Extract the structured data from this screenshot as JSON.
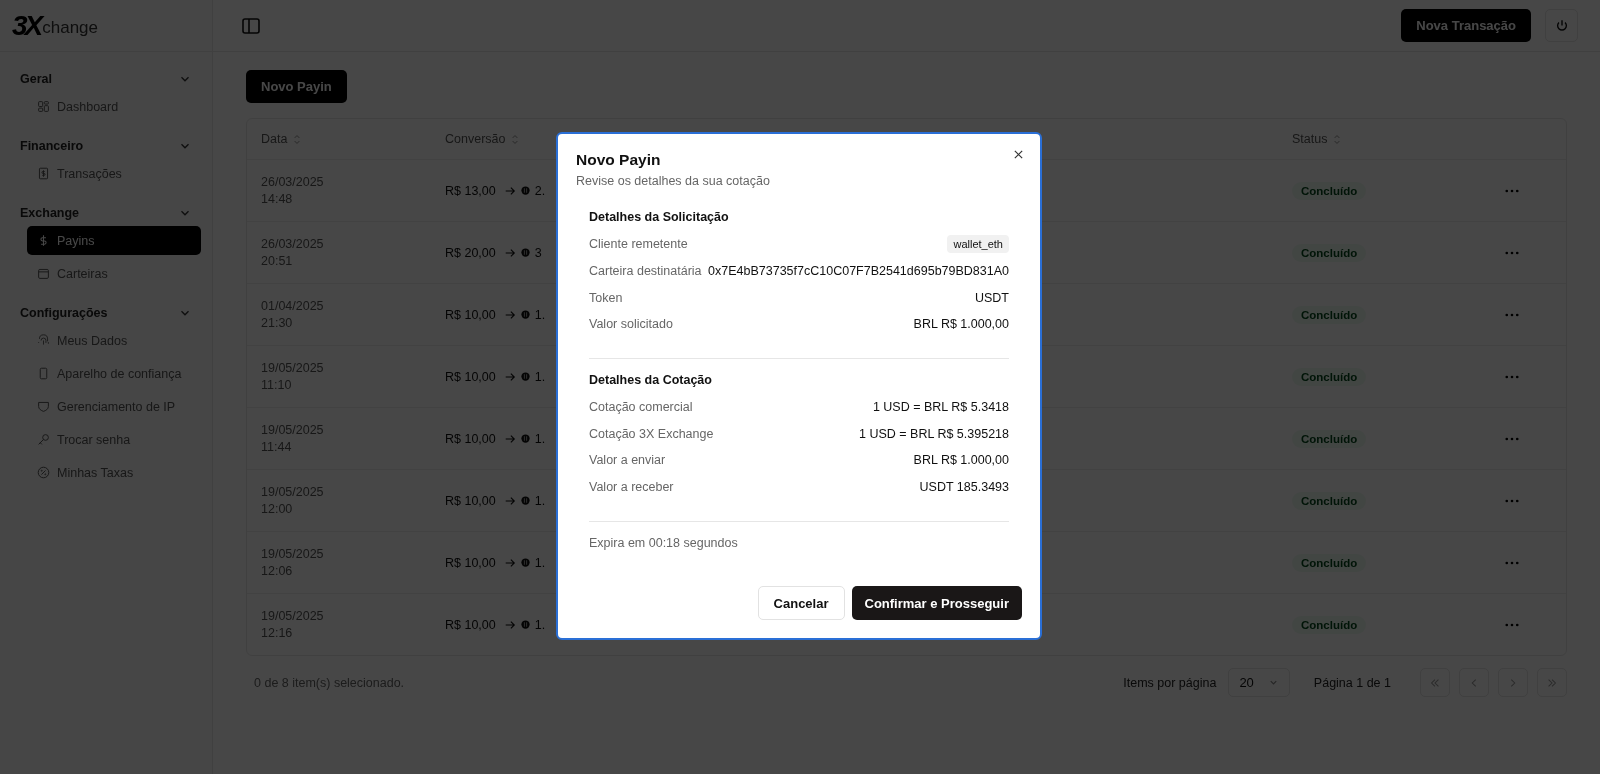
{
  "brand": {
    "logo_mark": "3X",
    "logo_text": "change"
  },
  "topbar": {
    "primary_button": "Nova Transação"
  },
  "sidebar": {
    "groups": [
      {
        "title": "Geral",
        "expanded": true,
        "items": [
          {
            "label": "Dashboard",
            "selected": false
          }
        ]
      },
      {
        "title": "Financeiro",
        "expanded": true,
        "items": [
          {
            "label": "Transações",
            "selected": false
          }
        ]
      },
      {
        "title": "Exchange",
        "expanded": true,
        "items": [
          {
            "label": "Payins",
            "selected": true
          },
          {
            "label": "Carteiras",
            "selected": false
          }
        ]
      },
      {
        "title": "Configurações",
        "expanded": true,
        "items": [
          {
            "label": "Meus Dados",
            "selected": false
          },
          {
            "label": "Aparelho de confiança",
            "selected": false
          },
          {
            "label": "Gerenciamento de IP",
            "selected": false
          },
          {
            "label": "Trocar senha",
            "selected": false
          },
          {
            "label": "Minhas Taxas",
            "selected": false
          }
        ]
      }
    ]
  },
  "page": {
    "new_button": "Novo Payin",
    "table": {
      "columns": [
        "Data",
        "Conversão",
        "Status"
      ],
      "rows": [
        {
          "date": "26/03/2025",
          "time": "14:48",
          "from": "R$ 13,00",
          "to": "2.",
          "status": "Concluído"
        },
        {
          "date": "26/03/2025",
          "time": "20:51",
          "from": "R$ 20,00",
          "to": "3",
          "status": "Concluído"
        },
        {
          "date": "01/04/2025",
          "time": "21:30",
          "from": "R$ 10,00",
          "to": "1.",
          "status": "Concluído"
        },
        {
          "date": "19/05/2025",
          "time": "11:10",
          "from": "R$ 10,00",
          "to": "1.",
          "status": "Concluído"
        },
        {
          "date": "19/05/2025",
          "time": "11:44",
          "from": "R$ 10,00",
          "to": "1.",
          "status": "Concluído"
        },
        {
          "date": "19/05/2025",
          "time": "12:00",
          "from": "R$ 10,00",
          "to": "1.",
          "status": "Concluído"
        },
        {
          "date": "19/05/2025",
          "time": "12:06",
          "from": "R$ 10,00",
          "to": "1.",
          "status": "Concluído"
        },
        {
          "date": "19/05/2025",
          "time": "12:16",
          "from": "R$ 10,00",
          "to": "1.",
          "status": "Concluído"
        }
      ]
    },
    "footer": {
      "selection": "0 de 8 item(s) selecionado.",
      "per_page_label": "Items por página",
      "per_page_value": "20",
      "page_info": "Página 1 de 1"
    }
  },
  "modal": {
    "title": "Novo Payin",
    "subtitle": "Revise os detalhes da sua cotação",
    "sections": [
      {
        "title": "Detalhes da Solicitação",
        "rows": [
          {
            "label": "Cliente remetente",
            "value": "wallet_eth",
            "kind": "tag"
          },
          {
            "label": "Carteira destinatária",
            "value": "0x7E4bB73735f7cC10C07F7B2541d695b79BD831A0",
            "kind": "plain"
          },
          {
            "label": "Token",
            "value": "USDT",
            "kind": "plain"
          },
          {
            "label": "Valor solicitado",
            "value": "BRL R$ 1.000,00",
            "kind": "plain"
          }
        ]
      },
      {
        "title": "Detalhes da Cotação",
        "rows": [
          {
            "label": "Cotação comercial",
            "value": "1 USD = BRL R$ 5.3418",
            "kind": "plain"
          },
          {
            "label": "Cotação 3X Exchange",
            "value": "1 USD = BRL R$ 5.395218",
            "kind": "plain"
          },
          {
            "label": "Valor a enviar",
            "value": "BRL R$ 1.000,00",
            "kind": "plain"
          },
          {
            "label": "Valor a receber",
            "value": "USDT 185.3493",
            "kind": "plain"
          }
        ]
      }
    ],
    "expiry": "Expira em 00:18 segundos",
    "buttons": {
      "cancel": "Cancelar",
      "confirm": "Confirmar e Prosseguir"
    }
  }
}
